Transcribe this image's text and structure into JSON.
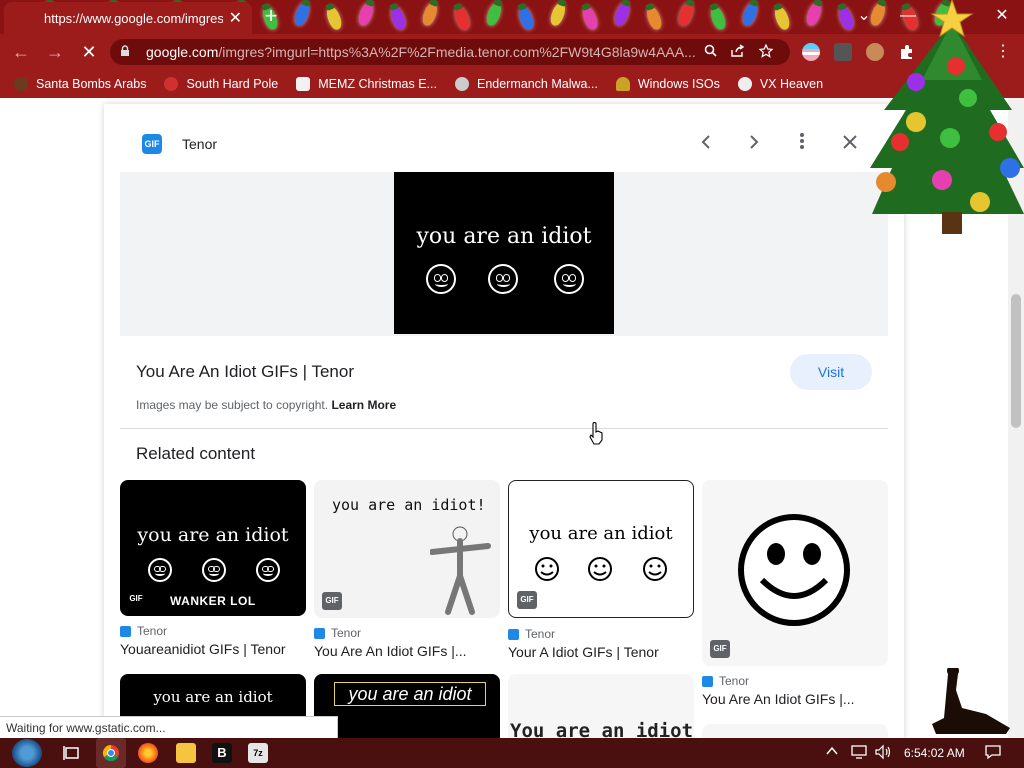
{
  "tab": {
    "title": "https://www.google.com/imgres",
    "close": "✕"
  },
  "window": {
    "new_tab": "+",
    "chevron": "⌄",
    "minimize": "—",
    "maximize": "❐",
    "close": "✕"
  },
  "nav": {
    "back": "←",
    "forward": "→",
    "stop": "✕"
  },
  "omnibox": {
    "host": "google.com",
    "path": "/imgres?imgurl=https%3A%2F%2Fmedia.tenor.com%2FW9t4G8la9w4AAA..."
  },
  "bookmarks": [
    {
      "label": "Santa Bombs Arabs",
      "icon": "santa-icon"
    },
    {
      "label": "South Hard Pole",
      "icon": "flower-icon"
    },
    {
      "label": "MEMZ Christmas E...",
      "icon": "page-icon"
    },
    {
      "label": "Endermanch Malwa...",
      "icon": "avatar-icon"
    },
    {
      "label": "Windows ISOs",
      "icon": "tree-icon"
    },
    {
      "label": "VX Heaven",
      "icon": "skull-icon"
    }
  ],
  "panel": {
    "source_name": "Tenor",
    "source_logo": "GIF",
    "preview_text": "you are an idiot",
    "result_title": "You Are An Idiot GIFs | Tenor",
    "visit_label": "Visit",
    "copyright_text": "Images may be subject to copyright.",
    "learn_more": "Learn More",
    "related_heading": "Related content"
  },
  "related": [
    {
      "thumb_text": "you are an idiot",
      "caption": "WANKER LOL",
      "badge": "GIF",
      "source": "Tenor",
      "title": "Youareanidiot GIFs | Tenor"
    },
    {
      "thumb_text": "you are an idiot!",
      "badge": "GIF",
      "source": "Tenor",
      "title": "You Are An Idiot GIFs |..."
    },
    {
      "thumb_text": "you are an idiot",
      "badge": "GIF",
      "source": "Tenor",
      "title": "Your A Idiot GIFs | Tenor"
    },
    {
      "badge": "GIF",
      "source": "Tenor",
      "title": "You Are An Idiot GIFs |..."
    }
  ],
  "row2": [
    {
      "thumb_text": "you are an idiot"
    },
    {
      "thumb_text": "you are an idiot"
    },
    {
      "thumb_text": "You are an idiot"
    }
  ],
  "status": "Waiting for www.gstatic.com...",
  "taskbar": {
    "clock": "6:54:02 AM"
  },
  "colors": {
    "chrome_red": "#9c1c1c",
    "tabstrip_red": "#8b1212",
    "link_blue": "#1a73e8",
    "visit_bg": "#e8f0fe"
  }
}
